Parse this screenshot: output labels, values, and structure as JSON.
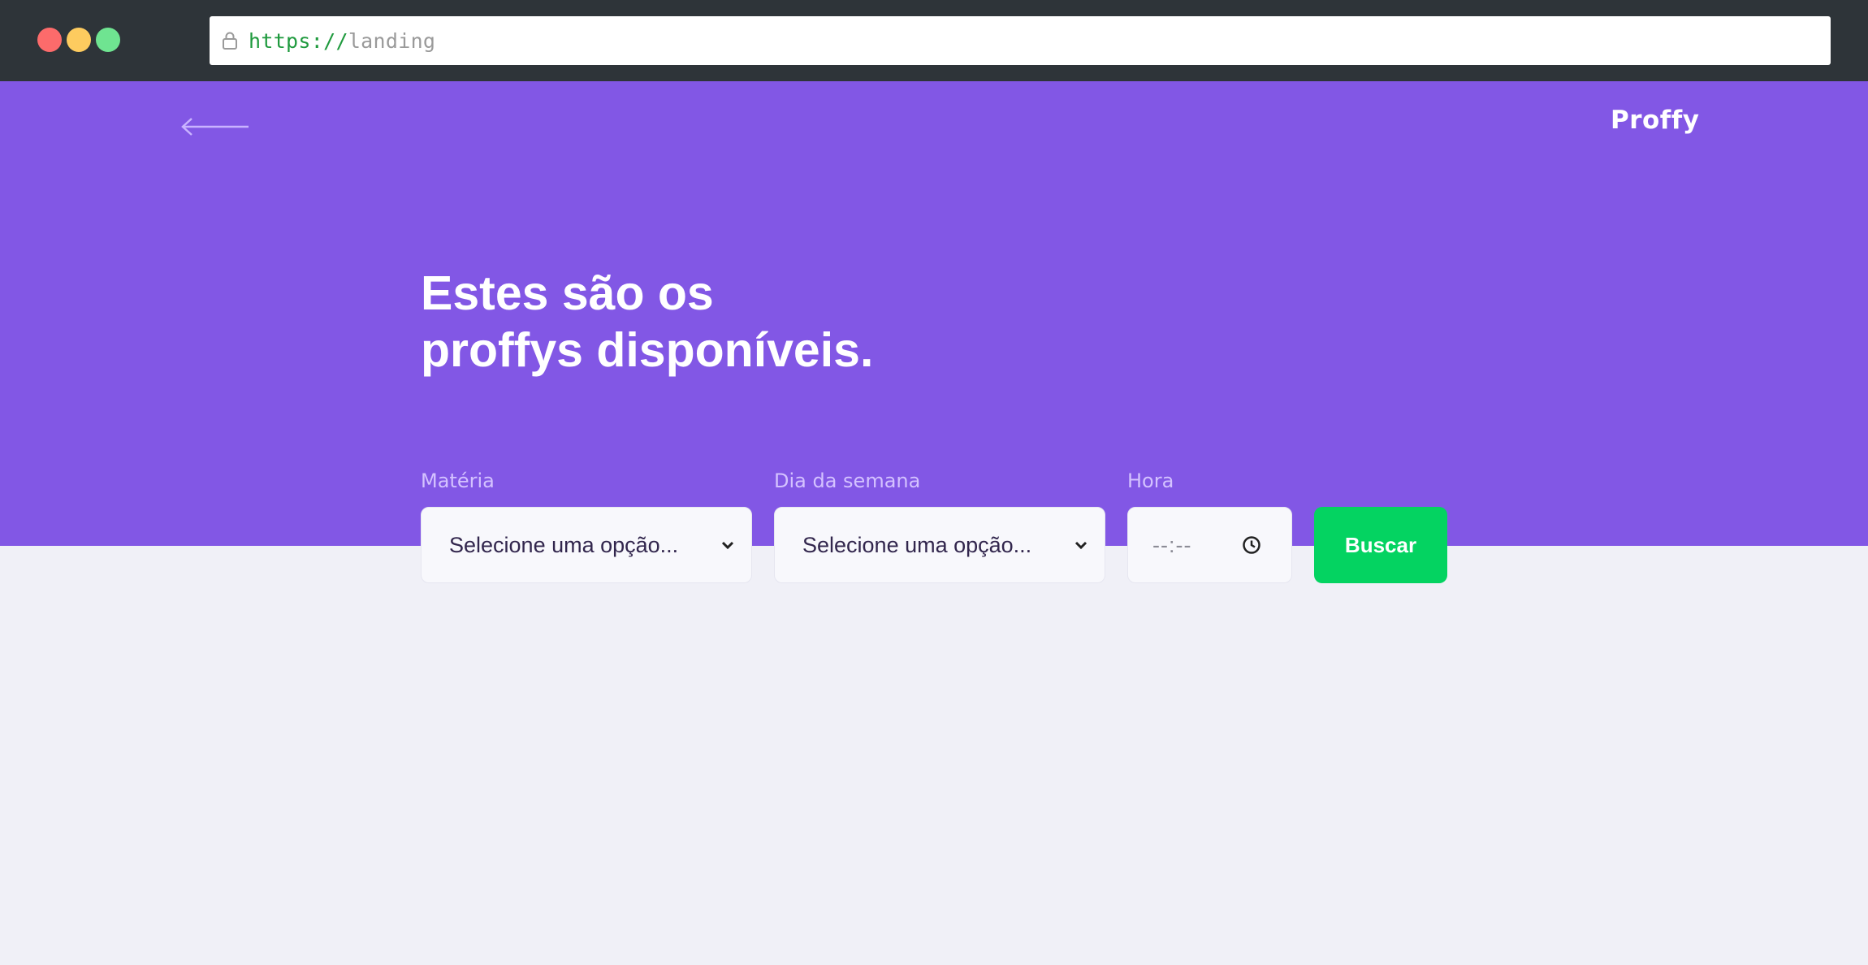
{
  "browser": {
    "url_scheme": "https://",
    "url_path": "landing"
  },
  "header": {
    "back_icon": "arrow-left-icon",
    "logo": "Proffy"
  },
  "hero": {
    "title_line1": "Estes são os",
    "title_line2": "proffys disponíveis."
  },
  "filters": {
    "subject_label": "Matéria",
    "subject_value": "Selecione uma opção...",
    "weekday_label": "Dia da semana",
    "weekday_value": "Selecione uma opção...",
    "time_label": "Hora",
    "time_value": "--:--",
    "search_button": "Buscar"
  },
  "colors": {
    "primary": "#8257e5",
    "secondary": "#04d361",
    "background": "#f0f0f7",
    "label": "#d4c2ff"
  }
}
